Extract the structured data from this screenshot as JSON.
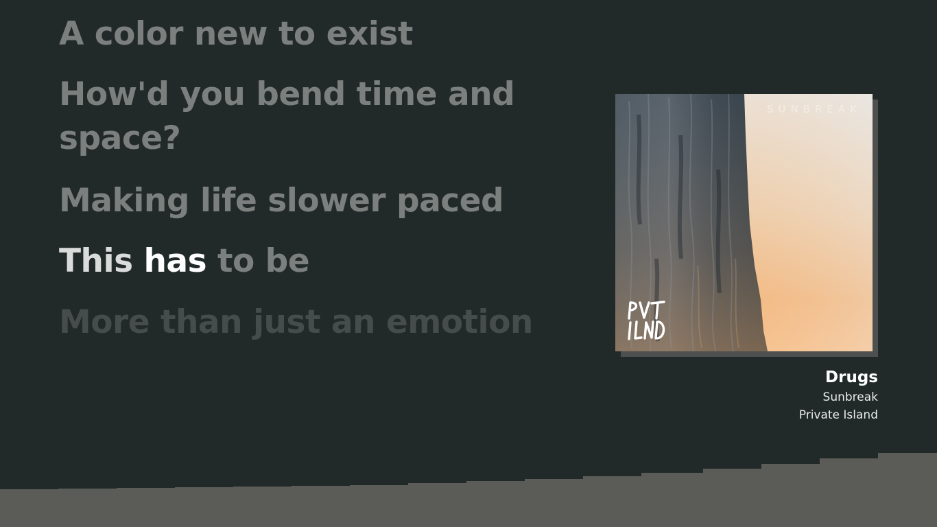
{
  "lyrics": {
    "lines": [
      {
        "state": "past",
        "text": "A color new to exist"
      },
      {
        "state": "past",
        "text": "How'd you bend time and space?"
      },
      {
        "state": "past",
        "text": "Making life slower paced"
      },
      {
        "state": "current",
        "sung": "This ",
        "active_word": "has",
        "unsung": " to be"
      },
      {
        "state": "upcoming",
        "text": "More than just an emotion"
      }
    ]
  },
  "now_playing": {
    "album_art_brand": "SUNBREAK",
    "album_art_monogram": "PVT ILND",
    "title": "Drugs",
    "album": "Sunbreak",
    "artist": "Private Island"
  },
  "colors": {
    "background": "#222a29",
    "lyric_past": "#7b7f7e",
    "lyric_current": "#ffffff",
    "lyric_upcoming": "#454c4b",
    "bottom_band": "#5b5c58"
  }
}
